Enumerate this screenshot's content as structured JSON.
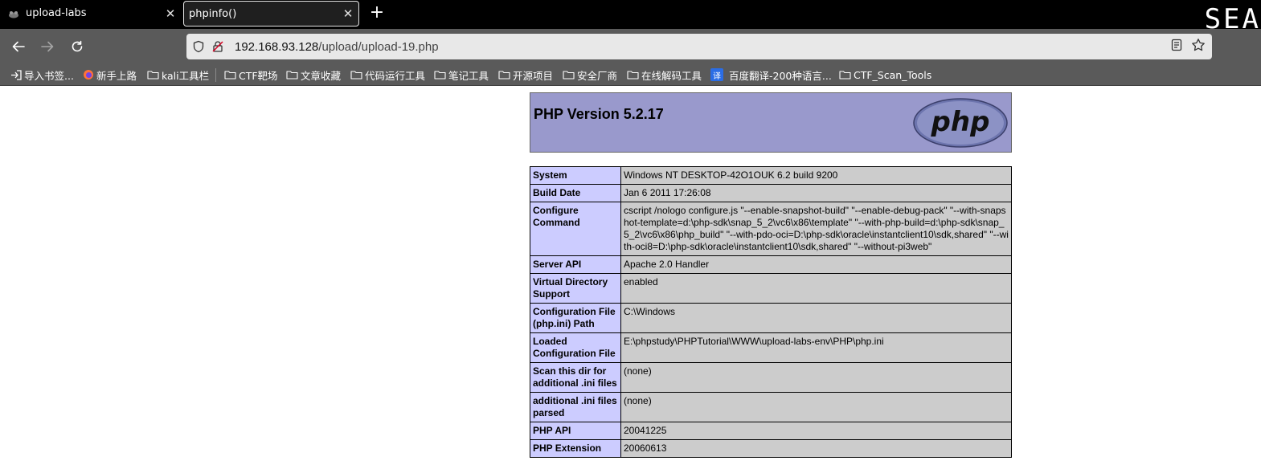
{
  "tabs": [
    {
      "label": "upload-labs"
    },
    {
      "label": "phpinfo()"
    }
  ],
  "corner_text": "SEA",
  "address": {
    "host": "192.168.93.128",
    "path": "/upload/upload-19.php"
  },
  "bookmarks": [
    {
      "label": "导入书签...",
      "icon": "import-icon"
    },
    {
      "label": "新手上路",
      "icon": "firefox-icon"
    },
    {
      "label": "kali工具栏",
      "icon": "folder-icon"
    },
    {
      "label": "CTF靶场",
      "icon": "folder-icon"
    },
    {
      "label": "文章收藏",
      "icon": "folder-icon"
    },
    {
      "label": "代码运行工具",
      "icon": "folder-icon"
    },
    {
      "label": "笔记工具",
      "icon": "folder-icon"
    },
    {
      "label": "开源项目",
      "icon": "folder-icon"
    },
    {
      "label": "安全厂商",
      "icon": "folder-icon"
    },
    {
      "label": "在线解码工具",
      "icon": "folder-icon"
    },
    {
      "label": "百度翻译-200种语言...",
      "icon": "translate-icon"
    },
    {
      "label": "CTF_Scan_Tools",
      "icon": "folder-icon"
    }
  ],
  "php": {
    "title": "PHP Version 5.2.17",
    "logo_text": "php",
    "colors": {
      "header_bg": "#9999cc",
      "label_bg": "#ccccff",
      "value_bg": "#cccccc"
    },
    "rows": [
      {
        "key": "System",
        "value": "Windows NT DESKTOP-42O1OUK 6.2 build 9200"
      },
      {
        "key": "Build Date",
        "value": "Jan 6 2011 17:26:08"
      },
      {
        "key": "Configure Command",
        "value": "cscript /nologo configure.js \"--enable-snapshot-build\" \"--enable-debug-pack\" \"--with-snapshot-template=d:\\php-sdk\\snap_5_2\\vc6\\x86\\template\" \"--with-php-build=d:\\php-sdk\\snap_5_2\\vc6\\x86\\php_build\" \"--with-pdo-oci=D:\\php-sdk\\oracle\\instantclient10\\sdk,shared\" \"--with-oci8=D:\\php-sdk\\oracle\\instantclient10\\sdk,shared\" \"--without-pi3web\""
      },
      {
        "key": "Server API",
        "value": "Apache 2.0 Handler"
      },
      {
        "key": "Virtual Directory Support",
        "value": "enabled"
      },
      {
        "key": "Configuration File (php.ini) Path",
        "value": "C:\\Windows"
      },
      {
        "key": "Loaded Configuration File",
        "value": "E:\\phpstudy\\PHPTutorial\\WWW\\upload-labs-env\\PHP\\php.ini"
      },
      {
        "key": "Scan this dir for additional .ini files",
        "value": "(none)"
      },
      {
        "key": "additional .ini files parsed",
        "value": "(none)"
      },
      {
        "key": "PHP API",
        "value": "20041225"
      },
      {
        "key": "PHP Extension",
        "value": "20060613"
      }
    ]
  }
}
